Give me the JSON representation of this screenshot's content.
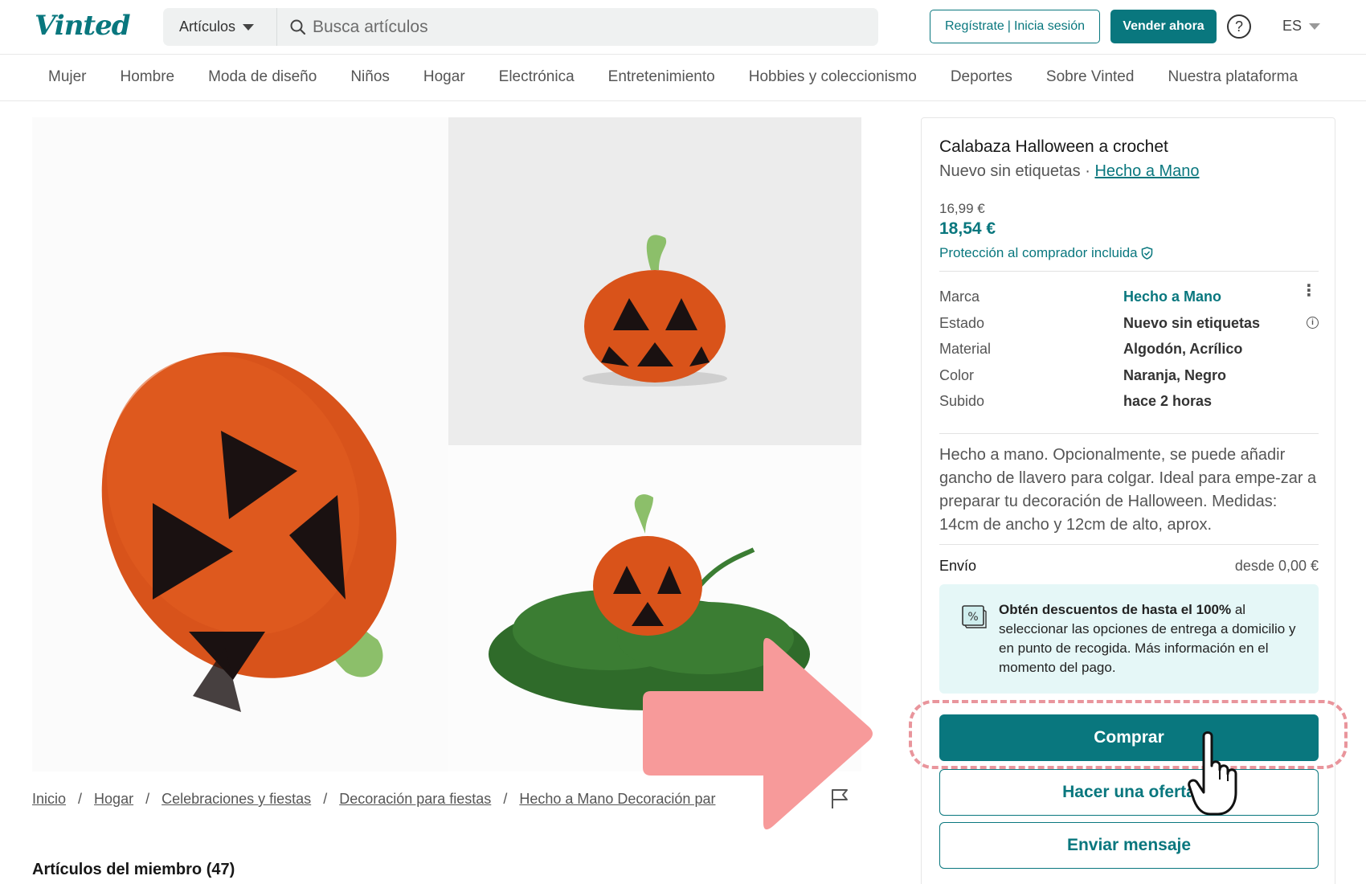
{
  "header": {
    "logo": "Vinted",
    "search_category": "Artículos",
    "search_placeholder": "Busca artículos",
    "register_label": "Regístrate",
    "login_label": "Inicia sesión",
    "sell_label": "Vender ahora",
    "help_symbol": "?",
    "language": "ES"
  },
  "categories": [
    "Mujer",
    "Hombre",
    "Moda de diseño",
    "Niños",
    "Hogar",
    "Electrónica",
    "Entretenimiento",
    "Hobbies y coleccionismo",
    "Deportes",
    "Sobre Vinted",
    "Nuestra plataforma"
  ],
  "breadcrumb": [
    "Inicio",
    "Hogar",
    "Celebraciones y fiestas",
    "Decoración para fiestas",
    "Hecho a Mano Decoración par"
  ],
  "member_items_title": "Artículos del miembro (47)",
  "item": {
    "title": "Calabaza Halloween a crochet",
    "condition": "Nuevo sin etiquetas",
    "brand_link": "Hecho a Mano",
    "price_original": "16,99 €",
    "price_total": "18,54 €",
    "protection": "Protección al comprador incluida",
    "details": [
      {
        "key": "Marca",
        "value": "Hecho a Mano"
      },
      {
        "key": "Estado",
        "value": "Nuevo sin etiquetas"
      },
      {
        "key": "Material",
        "value": "Algodón, Acrílico"
      },
      {
        "key": "Color",
        "value": "Naranja, Negro"
      },
      {
        "key": "Subido",
        "value": "hace 2 horas"
      }
    ],
    "description": "Hecho a mano. Opcionalmente, se puede añadir gancho de llavero para colgar. Ideal para empe-zar a preparar tu decoración de Halloween. Medidas: 14cm de ancho y 12cm de alto, aprox.",
    "shipping_label": "Envío",
    "shipping_value": "desde 0,00 €",
    "promo_bold": "Obtén descuentos de hasta el 100%",
    "promo_rest": " al seleccionar las opciones de entrega a domicilio y en punto de recogida. Más información en el momento del pago."
  },
  "actions": {
    "buy": "Comprar",
    "offer": "Hacer una oferta",
    "message": "Enviar mensaje"
  },
  "icons": {
    "search": "search-icon",
    "help": "help-icon",
    "shield": "shield-check-icon",
    "discount": "discount-tag-icon",
    "flag": "flag-icon",
    "hand": "pointing-hand-icon",
    "arrow": "arrow-right-icon"
  },
  "colors": {
    "brand": "#09777e",
    "promo_bg": "#e5f7f7",
    "highlight": "#e9959c",
    "arrow": "#f79a9a"
  }
}
